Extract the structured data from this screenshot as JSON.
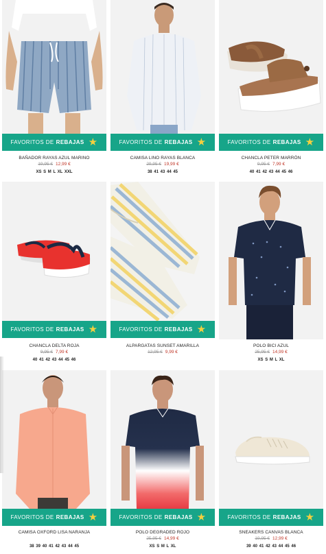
{
  "products": [
    {
      "name": "BAÑADOR RAYAS AZUL MARINO",
      "old_price": "19,95 €",
      "new_price": "12,99 €",
      "sizes": "XS S M L XL XXL",
      "icon": "swim-shorts-image"
    },
    {
      "name": "CAMISA LINO RAYAS BLANCA",
      "old_price": "29,95 €",
      "new_price": "19,99 €",
      "sizes": "38 41 43 44 45",
      "icon": "shirt-image"
    },
    {
      "name": "CHANCLA PETER MARRÓN",
      "old_price": "9,95 €",
      "new_price": "7,99 €",
      "sizes": "40 41 42 43 44 45 46",
      "icon": "flip-flop-image"
    },
    {
      "name": "CHANCLA DELTA ROJA",
      "old_price": "9,95 €",
      "new_price": "7,99 €",
      "sizes": "40 41 42 43 44 45 46",
      "icon": "flip-flop-image"
    },
    {
      "name": "ALPARGATAS SUNSET AMARILLA",
      "old_price": "12,95 €",
      "new_price": "9,99 €",
      "sizes": "",
      "icon": "espadrille-image"
    },
    {
      "name": "POLO BICI AZUL",
      "old_price": "25,95 €",
      "new_price": "14,99 €",
      "sizes": "XS S M L XL",
      "icon": "polo-image"
    },
    {
      "name": "CAMISA OXFORD LISA NARANJA",
      "old_price": "",
      "new_price": "",
      "sizes": "38 39 40 41 42 43 44 45",
      "icon": "shirt-image"
    },
    {
      "name": "POLO DEGRADED ROJO",
      "old_price": "25,95 €",
      "new_price": "14,99 €",
      "sizes": "XS S M L XL",
      "icon": "polo-image"
    },
    {
      "name": "SNEAKERS CANVAS BLANCA",
      "old_price": "19,95 €",
      "new_price": "12,99 €",
      "sizes": "39 40 41 42 43 44 45 46",
      "icon": "sneaker-image"
    }
  ],
  "banner": {
    "prefix": "FAVORITOS DE",
    "highlight": "REBAJAS",
    "icon": "star-icon"
  },
  "colors": {
    "banner": "#17a589",
    "sale": "#c0392b",
    "star": "#f4d03f"
  }
}
